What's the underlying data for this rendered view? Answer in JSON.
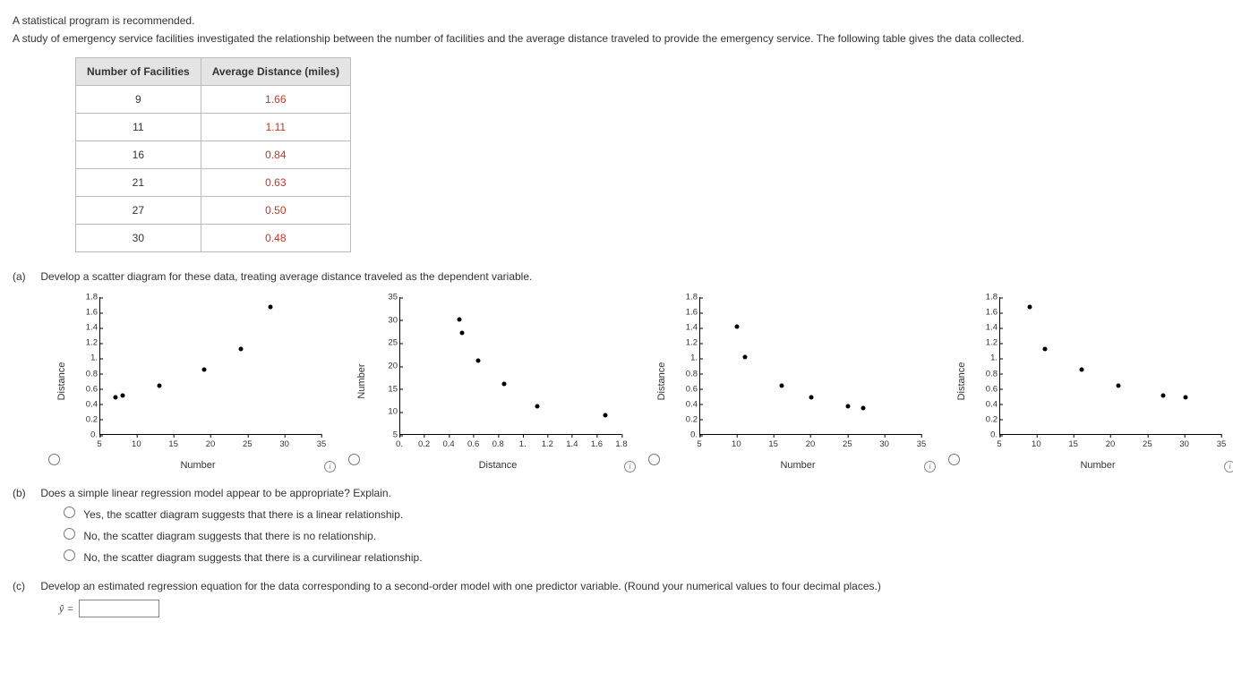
{
  "intro": {
    "p1": "A statistical program is recommended.",
    "p2": "A study of emergency service facilities investigated the relationship between the number of facilities and the average distance traveled to provide the emergency service. The following table gives the data collected."
  },
  "table": {
    "h1": "Number of Facilities",
    "h2": "Average Distance (miles)",
    "rows": [
      {
        "n": "9",
        "d": "1.66"
      },
      {
        "n": "11",
        "d": "1.11"
      },
      {
        "n": "16",
        "d": "0.84"
      },
      {
        "n": "21",
        "d": "0.63"
      },
      {
        "n": "27",
        "d": "0.50"
      },
      {
        "n": "30",
        "d": "0.48"
      }
    ]
  },
  "qa": {
    "label": "(a)",
    "text": "Develop a scatter diagram for these data, treating average distance traveled as the dependent variable."
  },
  "qb": {
    "label": "(b)",
    "text": "Does a simple linear regression model appear to be appropriate? Explain.",
    "opt1": "Yes, the scatter diagram suggests that there is a linear relationship.",
    "opt2": "No, the scatter diagram suggests that there is no relationship.",
    "opt3": "No, the scatter diagram suggests that there is a curvilinear relationship."
  },
  "qc": {
    "label": "(c)",
    "text": "Develop an estimated regression equation for the data corresponding to a second-order model with one predictor variable. (Round your numerical values to four decimal places.)",
    "yhat": "ŷ =",
    "value": ""
  },
  "axis_labels": {
    "distance": "Distance",
    "number": "Number"
  },
  "chart_data": [
    {
      "type": "scatter",
      "xlabel": "Number",
      "ylabel": "Distance",
      "xlim": [
        5,
        35
      ],
      "ylim": [
        0,
        1.8
      ],
      "xticks": [
        5,
        10,
        15,
        20,
        25,
        30,
        35
      ],
      "yticks": [
        0,
        0.2,
        0.4,
        0.6,
        0.8,
        1.0,
        1.2,
        1.4,
        1.6,
        1.8
      ],
      "points": [
        {
          "x": 7,
          "y": 0.48
        },
        {
          "x": 8,
          "y": 0.5
        },
        {
          "x": 13,
          "y": 0.63
        },
        {
          "x": 19,
          "y": 0.84
        },
        {
          "x": 24,
          "y": 1.11
        },
        {
          "x": 28,
          "y": 1.66
        }
      ]
    },
    {
      "type": "scatter",
      "xlabel": "Distance",
      "ylabel": "Number",
      "xlim": [
        0,
        1.8
      ],
      "ylim": [
        5,
        35
      ],
      "xticks": [
        0,
        0.2,
        0.4,
        0.6,
        0.8,
        1.0,
        1.2,
        1.4,
        1.6,
        1.8
      ],
      "yticks": [
        5,
        10,
        15,
        20,
        25,
        30,
        35
      ],
      "points": [
        {
          "x": 0.48,
          "y": 30
        },
        {
          "x": 0.5,
          "y": 27
        },
        {
          "x": 0.63,
          "y": 21
        },
        {
          "x": 0.84,
          "y": 16
        },
        {
          "x": 1.11,
          "y": 11
        },
        {
          "x": 1.66,
          "y": 9
        }
      ]
    },
    {
      "type": "scatter",
      "xlabel": "Number",
      "ylabel": "Distance",
      "xlim": [
        5,
        35
      ],
      "ylim": [
        0,
        1.8
      ],
      "xticks": [
        5,
        10,
        15,
        20,
        25,
        30,
        35
      ],
      "yticks": [
        0,
        0.2,
        0.4,
        0.6,
        0.8,
        1.0,
        1.2,
        1.4,
        1.6,
        1.8
      ],
      "points": [
        {
          "x": 10,
          "y": 1.4
        },
        {
          "x": 11,
          "y": 1.0
        },
        {
          "x": 16,
          "y": 0.63
        },
        {
          "x": 20,
          "y": 0.48
        },
        {
          "x": 25,
          "y": 0.36
        },
        {
          "x": 27,
          "y": 0.34
        }
      ]
    },
    {
      "type": "scatter",
      "xlabel": "Number",
      "ylabel": "Distance",
      "xlim": [
        5,
        35
      ],
      "ylim": [
        0,
        1.8
      ],
      "xticks": [
        5,
        10,
        15,
        20,
        25,
        30,
        35
      ],
      "yticks": [
        0,
        0.2,
        0.4,
        0.6,
        0.8,
        1.0,
        1.2,
        1.4,
        1.6,
        1.8
      ],
      "points": [
        {
          "x": 9,
          "y": 1.66
        },
        {
          "x": 11,
          "y": 1.11
        },
        {
          "x": 16,
          "y": 0.84
        },
        {
          "x": 21,
          "y": 0.63
        },
        {
          "x": 27,
          "y": 0.5
        },
        {
          "x": 30,
          "y": 0.48
        }
      ]
    }
  ]
}
